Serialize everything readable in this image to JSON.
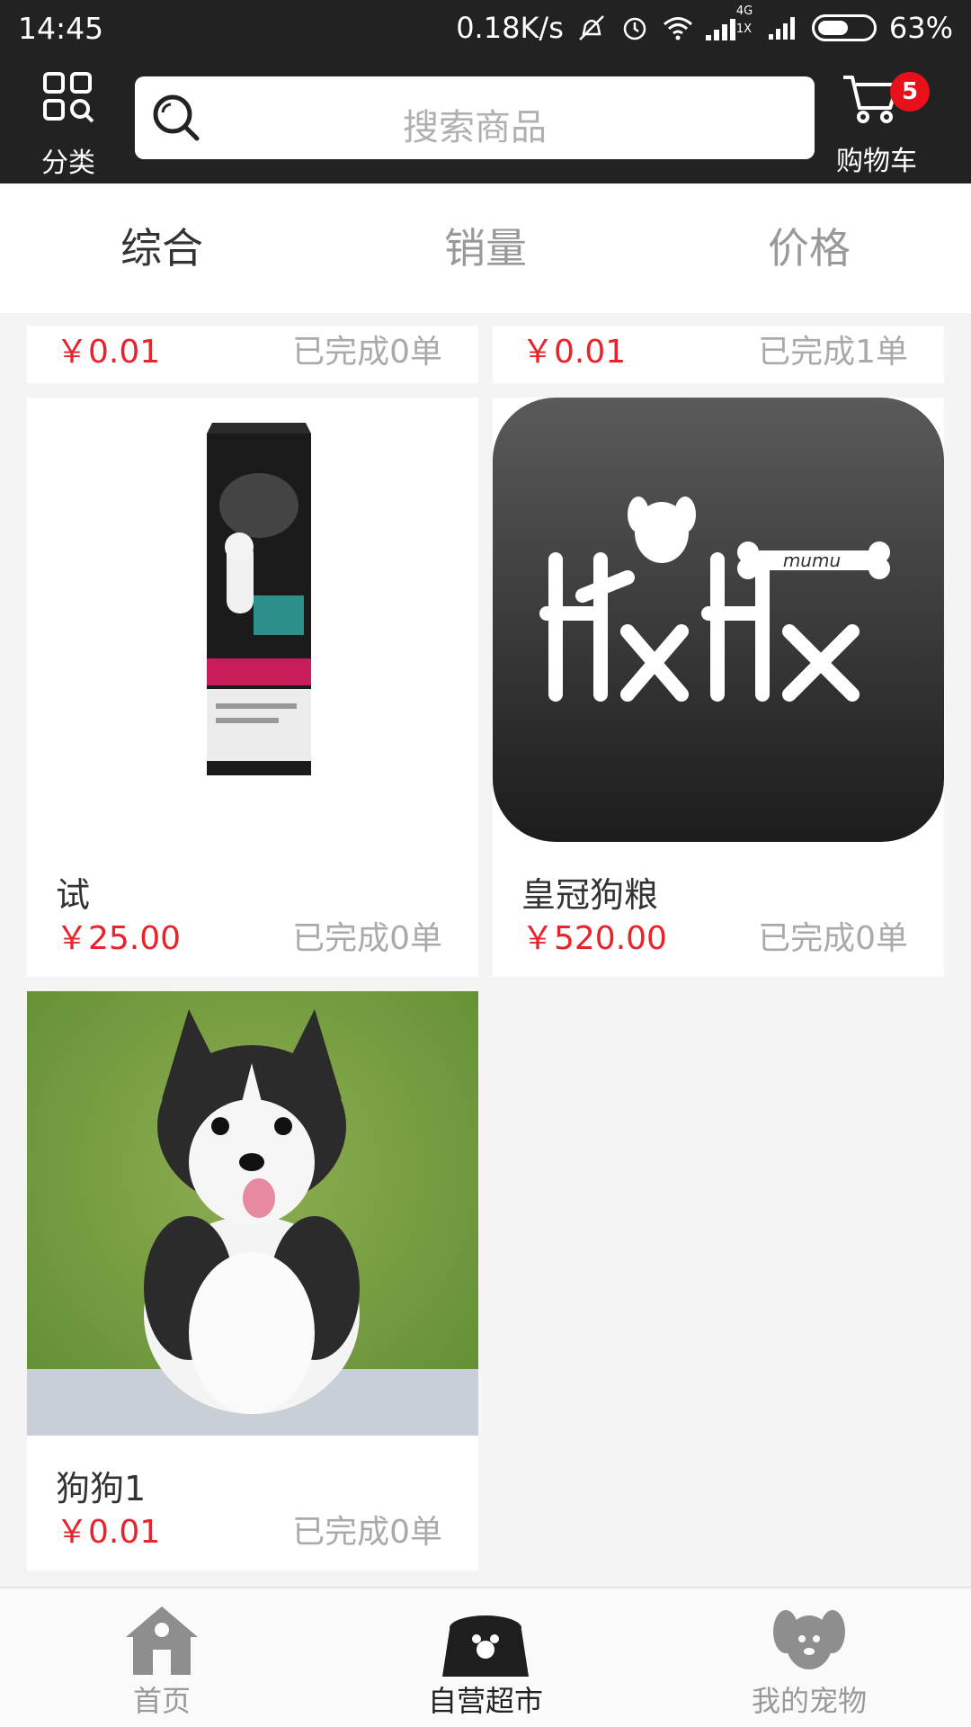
{
  "status_bar": {
    "time": "14:45",
    "net_speed": "0.18K/s",
    "net_type_top": "4G",
    "net_type_bottom": "1X",
    "battery": "63%",
    "battery_level": 0.63
  },
  "header": {
    "category_label": "分类",
    "search_placeholder": "搜索商品",
    "cart_label": "购物车",
    "cart_count": "5"
  },
  "sort_tabs": [
    {
      "label": "综合",
      "active": true
    },
    {
      "label": "销量",
      "active": false
    },
    {
      "label": "价格",
      "active": false
    }
  ],
  "products": [
    {
      "name": "",
      "price": "￥0.01",
      "sold": "已完成0单"
    },
    {
      "name": "",
      "price": "￥0.01",
      "sold": "已完成1单"
    },
    {
      "name": "试",
      "price": "￥25.00",
      "sold": "已完成0单",
      "image": "dog-food-bag-image"
    },
    {
      "name": "皇冠狗粮",
      "price": "￥520.00",
      "sold": "已完成0单",
      "image": "mumu-logo-image",
      "logo_text": "mumu"
    },
    {
      "name": "狗狗1",
      "price": "￥0.01",
      "sold": "已完成0单",
      "image": "husky-puppy-image"
    }
  ],
  "bottom_nav": [
    {
      "label": "首页",
      "icon": "home-icon",
      "active": false
    },
    {
      "label": "自营超市",
      "icon": "pet-bowl-icon",
      "active": true
    },
    {
      "label": "我的宠物",
      "icon": "dog-face-icon",
      "active": false
    }
  ],
  "colors": {
    "header_bg": "#222222",
    "price_red": "#e8232a",
    "badge_red": "#e8111b",
    "page_bg": "#f4f4f4"
  }
}
